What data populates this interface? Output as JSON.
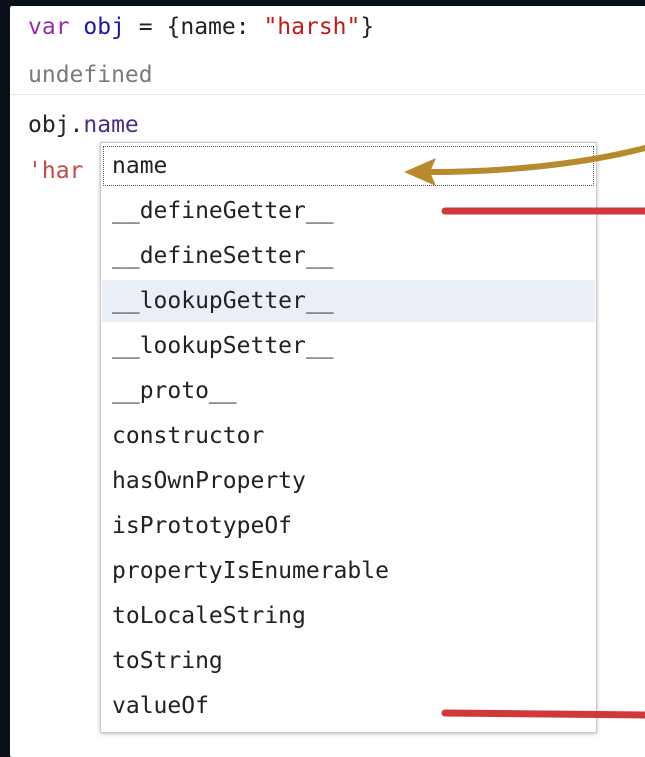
{
  "console": {
    "input_1": {
      "keyword": "var",
      "variable": "obj",
      "equals": " = ",
      "open": "{name: ",
      "string": "\"harsh\"",
      "close": "}"
    },
    "output_1": "undefined",
    "input_2": {
      "object": "obj.",
      "property": "name"
    },
    "output_2_partial": "'har"
  },
  "autocomplete": {
    "items": [
      "name",
      "__defineGetter__",
      "__defineSetter__",
      "__lookupGetter__",
      "__lookupSetter__",
      "__proto__",
      "constructor",
      "hasOwnProperty",
      "isPrototypeOf",
      "propertyIsEnumerable",
      "toLocaleString",
      "toString",
      "valueOf"
    ],
    "selected_index": 0,
    "hover_index": 3
  },
  "colors": {
    "keyword": "#9b2aa8",
    "string": "#c41a16",
    "arrow_gold": "#b78b2c",
    "annotation_red": "#d0393b"
  }
}
